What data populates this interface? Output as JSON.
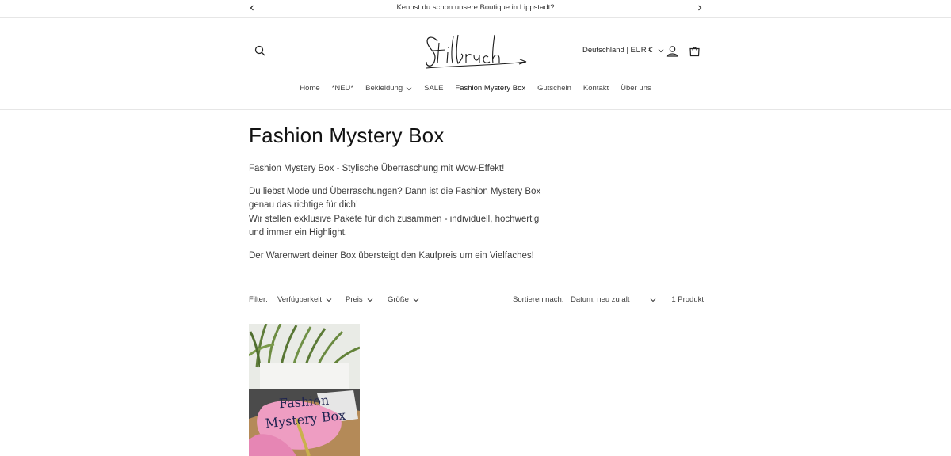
{
  "announcement": {
    "text": "Kennst du schon unsere Boutique in Lippstadt?"
  },
  "header": {
    "country_selector": "Deutschland | EUR €"
  },
  "nav": {
    "items": [
      {
        "label": "Home",
        "dropdown": false,
        "active": false
      },
      {
        "label": "*NEU*",
        "dropdown": false,
        "active": false
      },
      {
        "label": "Bekleidung",
        "dropdown": true,
        "active": false
      },
      {
        "label": "SALE",
        "dropdown": false,
        "active": false
      },
      {
        "label": "Fashion Mystery Box",
        "dropdown": false,
        "active": true
      },
      {
        "label": "Gutschein",
        "dropdown": false,
        "active": false
      },
      {
        "label": "Kontakt",
        "dropdown": false,
        "active": false
      },
      {
        "label": "Über uns",
        "dropdown": false,
        "active": false
      }
    ]
  },
  "collection": {
    "title": "Fashion Mystery Box",
    "description": {
      "p1": "Fashion Mystery Box - Stylische Überraschung mit Wow-Effekt!",
      "p2_line1": "Du liebst Mode und Überraschungen? Dann ist die Fashion Mystery Box genau das richtige für dich!",
      "p2_line2": "Wir stellen exklusive Pakete für dich zusammen - individuell, hochwertig und immer ein Highlight.",
      "p3": "Der Warenwert deiner Box übersteigt den Kaufpreis um ein Vielfaches!"
    }
  },
  "filters": {
    "label": "Filter:",
    "availability": "Verfügbarkeit",
    "price": "Preis",
    "size": "Größe",
    "sort_label": "Sortieren nach:",
    "sort_value": "Datum, neu zu alt",
    "product_count": "1 Produkt"
  },
  "product": {
    "image_text_line1": "Fashion",
    "image_text_line2": "Mystery Box"
  },
  "colors": {
    "text": "#121212",
    "muted": "#3d3d3d",
    "border": "#e6e6e6"
  }
}
